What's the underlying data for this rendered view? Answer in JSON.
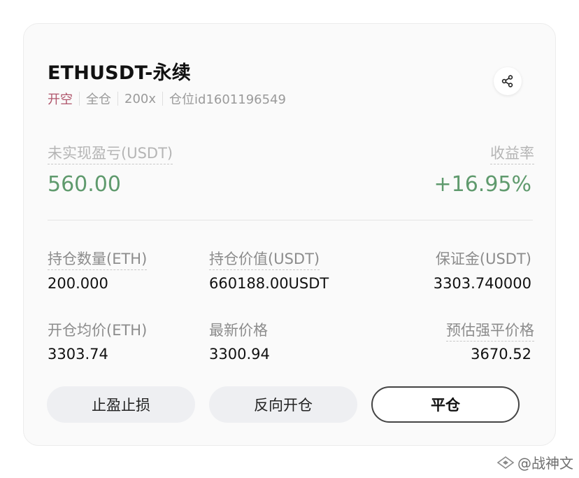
{
  "position": {
    "title": "ETHUSDT-永续",
    "tags": [
      "开空",
      "全仓",
      "200x",
      "仓位id1601196549"
    ]
  },
  "pnl": {
    "unrealized_label": "未实现盈亏(USDT)",
    "unrealized_value": "560.00",
    "roi_label": "收益率",
    "roi_value": "+16.95%"
  },
  "stats": {
    "size_label": "持仓数量(ETH)",
    "size_value": "200.000",
    "pos_value_label": "持仓价值(USDT)",
    "pos_value_value": "660188.00USDT",
    "margin_label": "保证金(USDT)",
    "margin_value": "3303.740000",
    "entry_label": "开仓均价(ETH)",
    "entry_value": "3303.74",
    "last_label": "最新价格",
    "last_value": "3300.94",
    "liq_label": "预估强平价格",
    "liq_value": "3670.52"
  },
  "actions": {
    "tpsl": "止盈止损",
    "reverse": "反向开仓",
    "close": "平仓"
  },
  "watermark": "@战神文",
  "colors": {
    "profit": "#5f9a6d",
    "short_tag": "#b0566c"
  }
}
